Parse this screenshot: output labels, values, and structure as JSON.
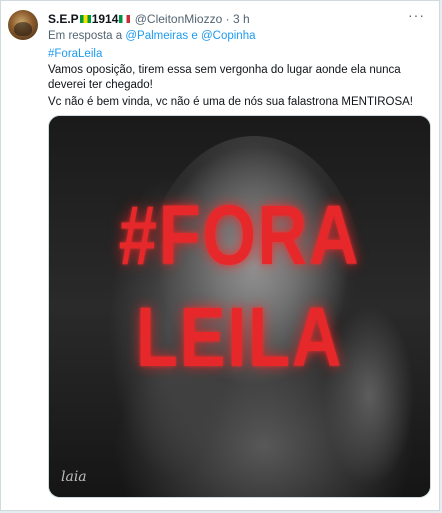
{
  "tweet": {
    "display_name": "S.E.P",
    "name_suffix": "1914",
    "handle": "@CleitonMiozzo",
    "separator": "·",
    "time": "3 h",
    "more_label": "···",
    "reply_prefix": "Em resposta a",
    "reply_to_1": "@Palmeiras",
    "reply_joiner": "e",
    "reply_to_2": "@Copinha",
    "hashtag": "#ForaLeila",
    "body_line_1": "Vamos oposição, tirem essa sem vergonha do lugar aonde ela nunca deverei ter chegado!",
    "body_line_2": "Vc não é bem vinda, vc não é uma de nós sua falastrona MENTIROSA!",
    "media": {
      "text_line_1": "#FORA",
      "text_line_2": "LEILA",
      "watermark": "laia",
      "overlay_color": "#e6282b"
    }
  },
  "colors": {
    "link": "#1d9bf0",
    "secondary_text": "#536471",
    "primary_text": "#0f1419",
    "border": "#cfd9de"
  }
}
